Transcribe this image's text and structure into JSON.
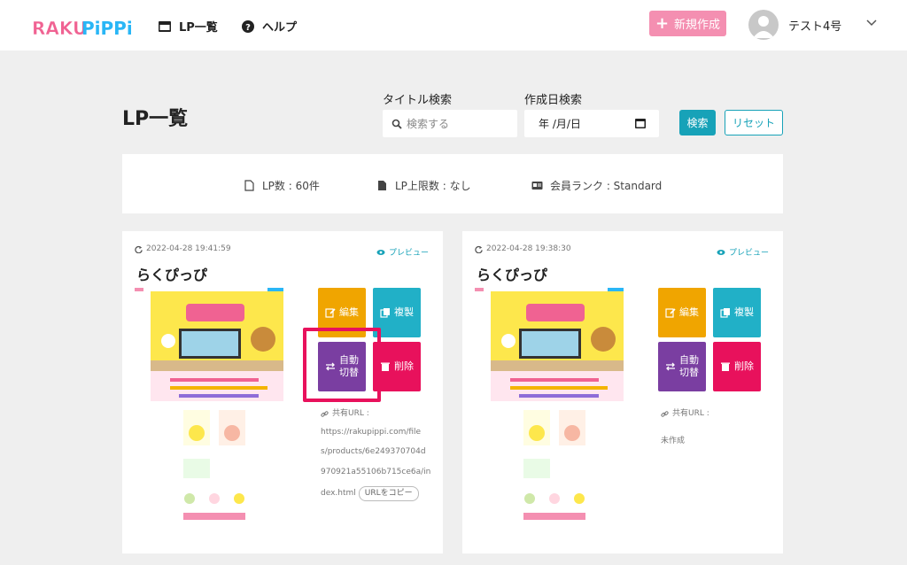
{
  "header": {
    "logo_text": "RAKU PIPPI",
    "nav": [
      {
        "label": "LP一覧",
        "icon": "folder-icon"
      },
      {
        "label": "ヘルプ",
        "icon": "help-circle-icon"
      }
    ],
    "new_button_label": "新規作成",
    "user_name": "テスト4号"
  },
  "page": {
    "title": "LP一覧",
    "search": {
      "title_label": "タイトル検索",
      "title_placeholder": "検索する",
      "date_label": "作成日検索",
      "date_value": "年 /月/日",
      "search_button": "検索",
      "reset_button": "リセット"
    },
    "info": {
      "lp_count": "LP数 : 60件",
      "lp_limit": "LP上限数 : なし",
      "rank": "会員ランク : Standard"
    }
  },
  "cards": [
    {
      "date": "2022-04-28 19:41:59",
      "preview_label": "プレビュー",
      "title": "らくぴっぴ",
      "actions": {
        "edit": "編集",
        "copy": "複製",
        "auto_line1": "自動",
        "auto_line2": "切替",
        "delete": "削除"
      },
      "share_label": "共有URL :",
      "share_url_lines": [
        "https://rakupippi.com/file",
        "s/products/6e249370704d",
        "970921a55106b715ce6a/in",
        "dex.html"
      ],
      "copy_button": "URLをコピー"
    },
    {
      "date": "2022-04-28 19:38:30",
      "preview_label": "プレビュー",
      "title": "らくぴっぴ",
      "actions": {
        "edit": "編集",
        "copy": "複製",
        "auto_line1": "自動",
        "auto_line2": "切替",
        "delete": "削除"
      },
      "share_label": "共有URL :",
      "share_status": "未作成"
    }
  ],
  "colors": {
    "accent": "#17a2b8",
    "new_button": "#f48fb1",
    "edit": "#f0a500",
    "copy": "#21b0c7",
    "auto": "#7a3ea1",
    "delete": "#e8115c",
    "highlight": "#e8115c"
  }
}
